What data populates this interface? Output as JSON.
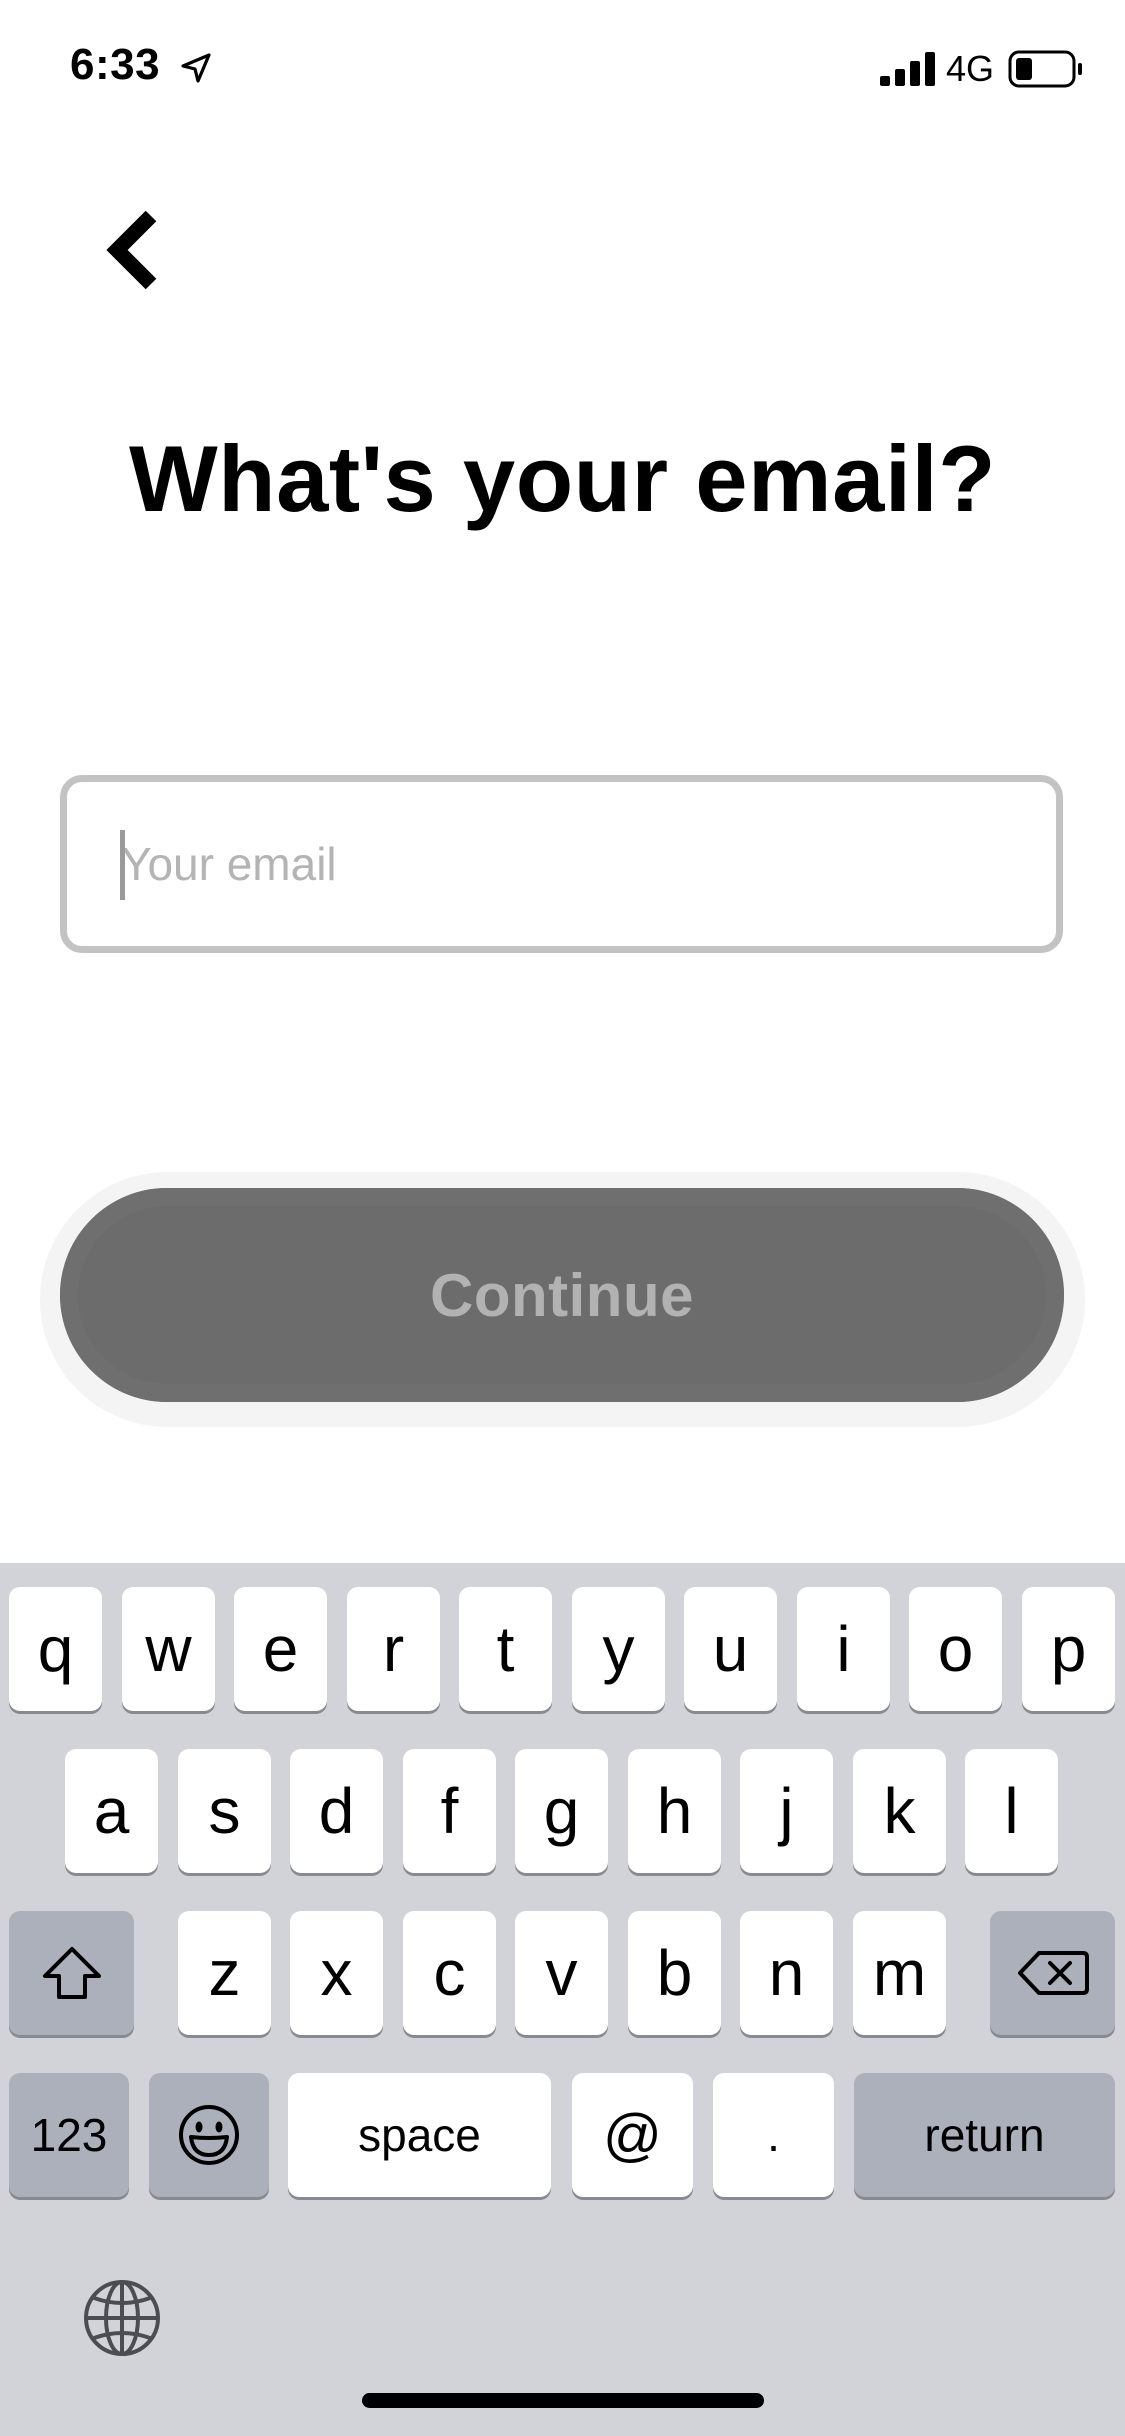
{
  "status_bar": {
    "time": "6:33",
    "network": "4G",
    "icons": [
      "location-arrow-icon",
      "signal-bars-icon",
      "battery-icon"
    ]
  },
  "header": {
    "back_icon": "chevron-left-icon",
    "title": "What's your email?"
  },
  "form": {
    "email": {
      "value": "",
      "placeholder": "Your email"
    },
    "continue_label": "Continue",
    "continue_enabled": false
  },
  "keyboard": {
    "row1": [
      "q",
      "w",
      "e",
      "r",
      "t",
      "y",
      "u",
      "i",
      "o",
      "p"
    ],
    "row2": [
      "a",
      "s",
      "d",
      "f",
      "g",
      "h",
      "j",
      "k",
      "l"
    ],
    "row3": [
      "z",
      "x",
      "c",
      "v",
      "b",
      "n",
      "m"
    ],
    "bottom": {
      "numbers": "123",
      "space": "space",
      "at": "@",
      "dot": ".",
      "return": "return"
    },
    "icons": {
      "shift": "shift-icon",
      "delete": "delete-icon",
      "emoji": "emoji-icon",
      "globe": "globe-icon"
    }
  },
  "colors": {
    "button_disabled": "#6c6c6c",
    "button_text_disabled": "#b2b2b2",
    "input_border": "#c3c3c3",
    "keyboard_bg": "#d1d3d9"
  }
}
